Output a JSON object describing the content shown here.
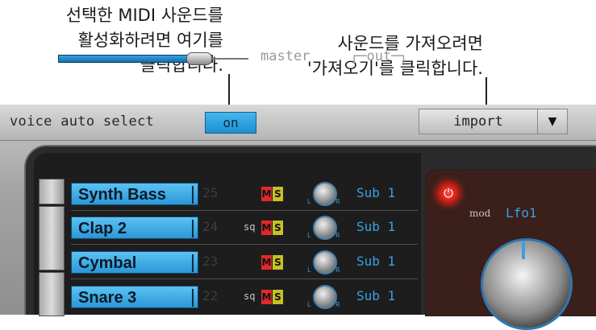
{
  "callouts": {
    "left": [
      "선택한 MIDI 사운드를",
      "활성화하려면 여기를",
      "클릭합니다."
    ],
    "right": [
      "사운드를 가져오려면",
      "'가져오기'를 클릭합니다."
    ]
  },
  "header": {
    "voice_auto_select_label": "voice auto select",
    "on_label": "on",
    "import_label": "import",
    "dropdown_glyph": "▼"
  },
  "mixer": {
    "master_label": "master",
    "out_label": "┌─out─┐",
    "rows": [
      {
        "name": "Synth Bass",
        "number": "25",
        "sq": "",
        "m": "M",
        "s": "S",
        "pan_l": "L",
        "pan_r": "R",
        "out": "Sub 1"
      },
      {
        "name": "Clap 2",
        "number": "24",
        "sq": "sq",
        "m": "M",
        "s": "S",
        "pan_l": "L",
        "pan_r": "R",
        "out": "Sub 1"
      },
      {
        "name": "Cymbal",
        "number": "23",
        "sq": "",
        "m": "M",
        "s": "S",
        "pan_l": "L",
        "pan_r": "R",
        "out": "Sub 1"
      },
      {
        "name": "Snare 3",
        "number": "22",
        "sq": "sq",
        "m": "M",
        "s": "S",
        "pan_l": "L",
        "pan_r": "R",
        "out": "Sub 1"
      }
    ]
  },
  "lfo": {
    "power_glyph": "⏻",
    "mod_label": "mod",
    "mod_value": "Lfo1"
  },
  "colors": {
    "accent_blue": "#2b97d6",
    "mute_red": "#e02a2a",
    "solo_yellow": "#c8c024",
    "power_red": "#ff4a3a"
  }
}
